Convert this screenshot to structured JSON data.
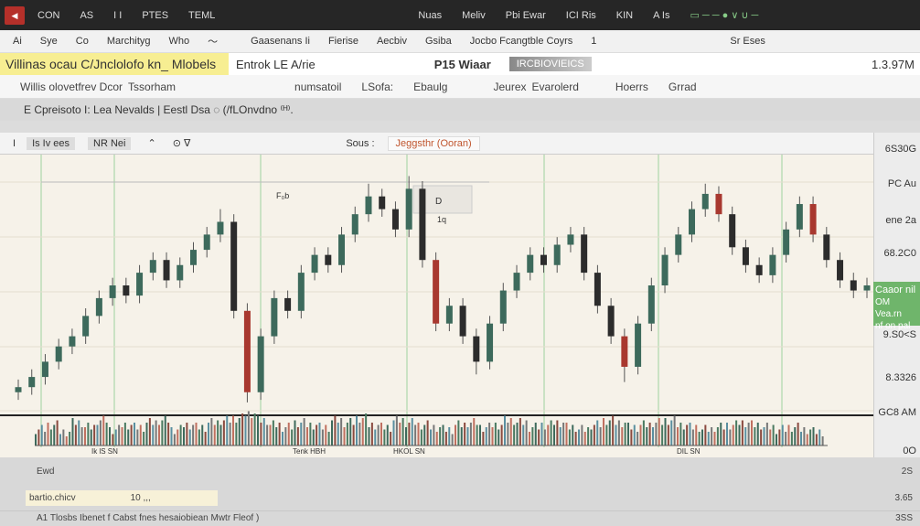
{
  "topbar": {
    "items": [
      "CON",
      "AS",
      "I I",
      "PTES",
      "TEML",
      "Nuas",
      "Meliv",
      "Pbi Ewar",
      "ICI Ris",
      "KIN",
      "A Is"
    ]
  },
  "menu": {
    "items": [
      "Ai",
      "Sye",
      "Co",
      "Marchityg",
      "Who",
      "Gaasenans Ii",
      "Fierise",
      "Aecbiv",
      "Gsiba",
      "Jocbo Fcangtble Coyrs",
      "1",
      "Sr Eses"
    ]
  },
  "banner": {
    "highlight": "Villinas ocau  C/Jnclolofo kn_ Mlobels",
    "item1": "Entrok  LE A/rie",
    "item2": "P15 Wiaar",
    "gray_box": "IRCBIOVIEICS",
    "value": "1.3.97M"
  },
  "toolbar": {
    "items": [
      "Willis olovetfrev Dcor",
      "Tssorham",
      "numsatoil",
      "LSofa:",
      "Ebaulg",
      "Jeurex",
      "Evarolerd",
      "Hoerrs",
      "Grrad"
    ]
  },
  "info": {
    "text": "E Cpreisoto I: Lea Nevalds | Eestl Dsa ◌  (/fLOnvdno ⁽ᴴ⁾."
  },
  "chart_header": {
    "left": "I",
    "symbol": "Is Iv ees",
    "tf": "NR Nei",
    "search_label": "Sous :",
    "search_value": "Jeggsthr (Ooran)"
  },
  "price_axis": [
    "6S30G",
    "PC Au",
    "ene 2a",
    "68.2C0",
    "9.S0<S",
    "8.3326",
    "GC8 AM",
    "0O"
  ],
  "current_price": {
    "title": "Caaor nil",
    "line2": "OM Vea.rn",
    "line3": "nf on pal"
  },
  "time_axis": [
    "Ik lS SN",
    "Tenk HBH",
    "HKOL SN",
    "DIL SN"
  ],
  "chart_labels": {
    "a": "F₀b",
    "b": "D",
    "c": "1q"
  },
  "bottom": {
    "row1": "Ewd",
    "input": "bartio.chicv",
    "input2": "10 ,,,",
    "status": "A1 Tlosbs Ibenet f Cabst fnes hesaiobiean Mwtr Fleof )",
    "right": [
      "2S",
      "3.65",
      "3SS"
    ]
  },
  "colors": {
    "up": "#3d6a5c",
    "down": "#2c2c2c",
    "red": "#a8382f",
    "bg": "#f6f2e9",
    "accent": "#6fb56b"
  },
  "chart_data": {
    "type": "candlestick",
    "candles": [
      [
        8,
        13,
        5,
        10
      ],
      [
        10,
        17,
        7,
        14
      ],
      [
        14,
        23,
        11,
        20
      ],
      [
        20,
        29,
        17,
        26
      ],
      [
        26,
        33,
        23,
        30
      ],
      [
        30,
        41,
        27,
        38
      ],
      [
        38,
        48,
        35,
        45
      ],
      [
        45,
        53,
        42,
        50
      ],
      [
        50,
        53,
        43,
        46
      ],
      [
        46,
        58,
        43,
        55
      ],
      [
        55,
        63,
        52,
        60
      ],
      [
        60,
        63,
        49,
        52
      ],
      [
        52,
        61,
        49,
        58
      ],
      [
        58,
        67,
        55,
        64
      ],
      [
        64,
        73,
        61,
        70
      ],
      [
        70,
        80,
        67,
        75
      ],
      [
        75,
        78,
        37,
        40
      ],
      [
        40,
        43,
        4,
        8
      ],
      [
        8,
        33,
        5,
        30
      ],
      [
        30,
        48,
        27,
        45
      ],
      [
        45,
        48,
        37,
        40
      ],
      [
        40,
        58,
        37,
        55
      ],
      [
        55,
        65,
        52,
        62
      ],
      [
        62,
        65,
        55,
        58
      ],
      [
        58,
        73,
        55,
        70
      ],
      [
        70,
        81,
        67,
        78
      ],
      [
        78,
        90,
        75,
        85
      ],
      [
        85,
        88,
        77,
        80
      ],
      [
        80,
        83,
        69,
        72
      ],
      [
        72,
        93,
        69,
        88
      ],
      [
        88,
        91,
        57,
        60
      ],
      [
        60,
        63,
        32,
        35
      ],
      [
        35,
        45,
        32,
        42
      ],
      [
        42,
        45,
        27,
        30
      ],
      [
        30,
        33,
        15,
        20
      ],
      [
        20,
        38,
        17,
        35
      ],
      [
        35,
        51,
        32,
        48
      ],
      [
        48,
        58,
        45,
        55
      ],
      [
        55,
        65,
        52,
        62
      ],
      [
        62,
        65,
        55,
        58
      ],
      [
        58,
        69,
        55,
        66
      ],
      [
        66,
        73,
        63,
        70
      ],
      [
        70,
        73,
        52,
        55
      ],
      [
        55,
        58,
        39,
        42
      ],
      [
        42,
        45,
        27,
        30
      ],
      [
        30,
        33,
        12,
        18
      ],
      [
        18,
        38,
        15,
        35
      ],
      [
        35,
        53,
        32,
        50
      ],
      [
        50,
        65,
        47,
        62
      ],
      [
        62,
        73,
        59,
        70
      ],
      [
        70,
        83,
        67,
        80
      ],
      [
        80,
        90,
        77,
        86
      ],
      [
        86,
        89,
        75,
        78
      ],
      [
        78,
        81,
        62,
        65
      ],
      [
        65,
        68,
        55,
        58
      ],
      [
        58,
        61,
        51,
        54
      ],
      [
        54,
        65,
        51,
        62
      ],
      [
        62,
        75,
        59,
        72
      ],
      [
        72,
        85,
        69,
        82
      ],
      [
        82,
        85,
        67,
        70
      ],
      [
        70,
        73,
        57,
        60
      ],
      [
        60,
        63,
        49,
        52
      ],
      [
        52,
        55,
        45,
        48
      ],
      [
        48,
        53,
        45,
        50
      ]
    ],
    "volume": [
      5,
      7,
      4,
      8,
      6,
      9,
      5,
      7,
      6,
      8,
      9,
      5,
      7,
      6,
      8,
      9,
      10,
      12,
      9,
      7,
      6,
      8,
      7,
      6,
      9,
      8,
      10,
      7,
      6,
      9,
      8,
      7,
      6,
      5,
      7,
      8,
      6,
      7,
      9,
      8,
      6,
      7,
      8,
      6,
      5,
      7,
      9,
      8,
      6,
      7,
      8,
      9,
      7,
      6,
      5,
      6,
      7,
      8,
      7,
      6,
      5,
      6,
      5,
      4
    ],
    "ylim": [
      0,
      100
    ],
    "grid": true
  }
}
